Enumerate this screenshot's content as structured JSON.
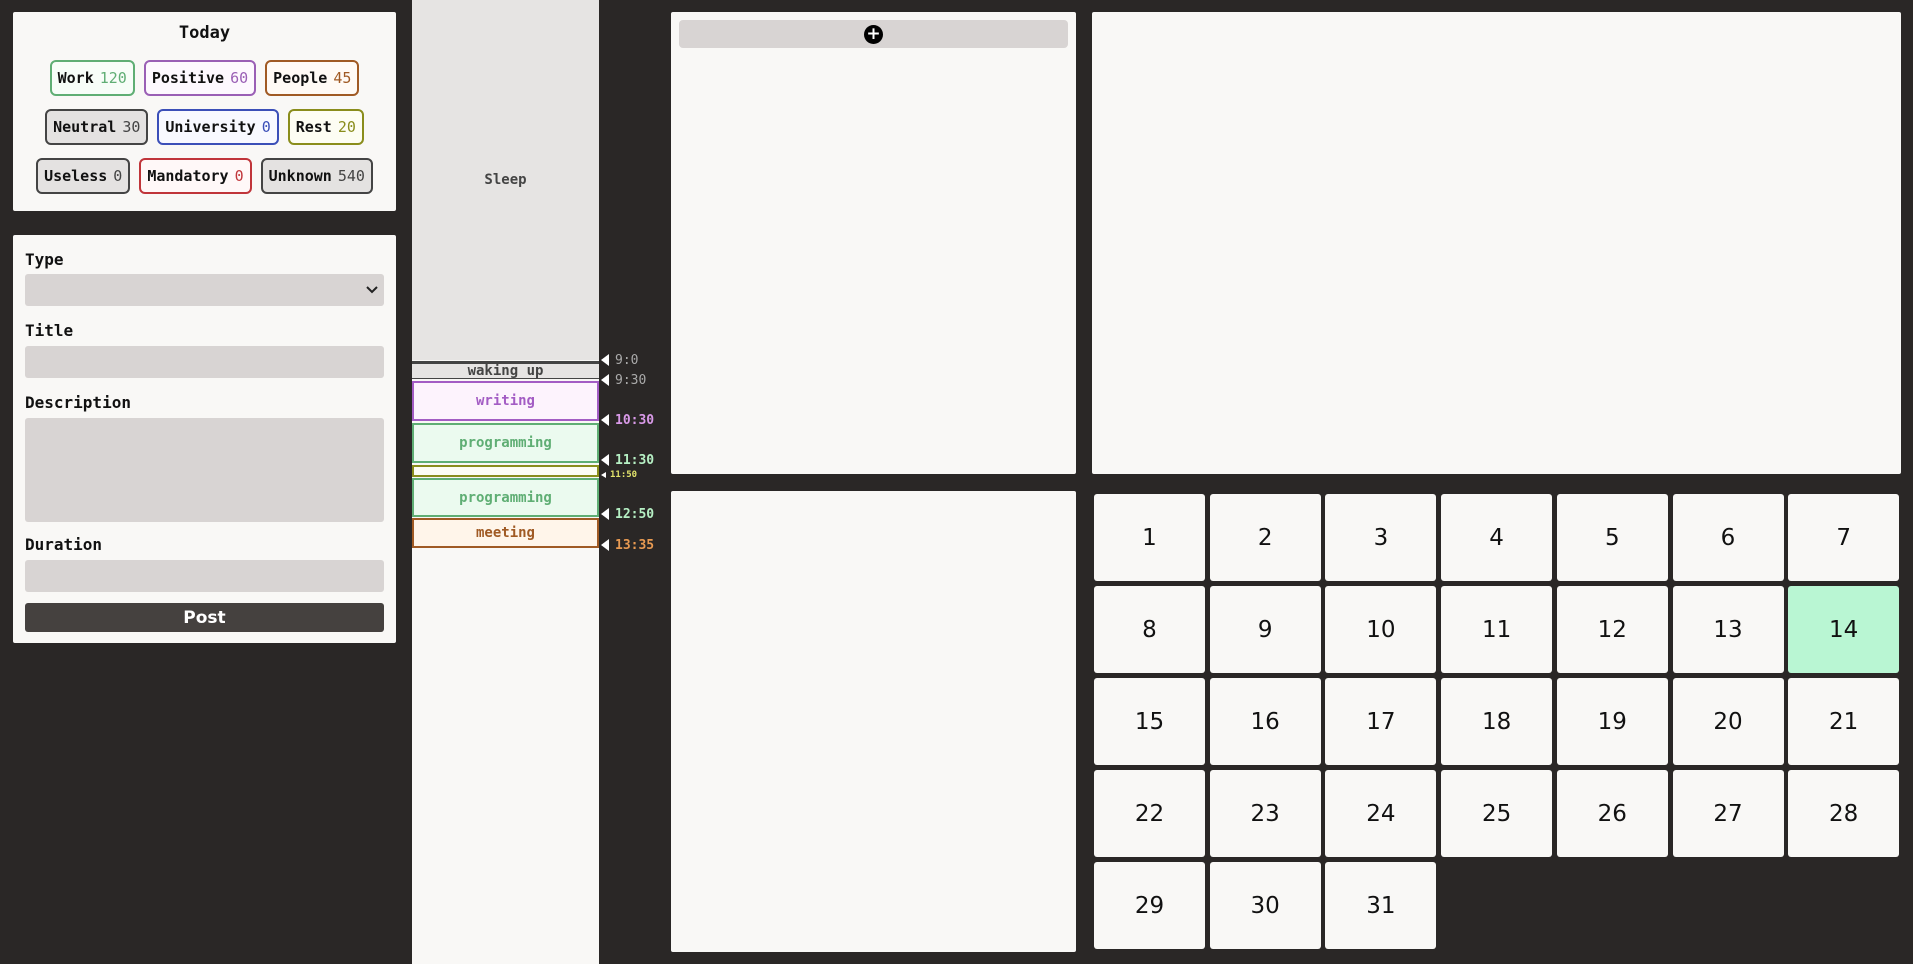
{
  "summary": {
    "title": "Today",
    "tags": [
      {
        "name": "Work",
        "count": "120",
        "border": "#5fae74",
        "color": "#5fae74",
        "bg": "#f7fdf8"
      },
      {
        "name": "Positive",
        "count": "60",
        "border": "#9a5fb5",
        "color": "#9a5fb5",
        "bg": "#fdf8fe"
      },
      {
        "name": "People",
        "count": "45",
        "border": "#a05a24",
        "color": "#a05a24",
        "bg": "#fffaf5"
      },
      {
        "name": "Neutral",
        "count": "30",
        "border": "#444444",
        "color": "#444444",
        "bg": "#e4e2e1"
      },
      {
        "name": "University",
        "count": "0",
        "border": "#3b4fb8",
        "color": "#3b4fb8",
        "bg": "#f8f9ff"
      },
      {
        "name": "Rest",
        "count": "20",
        "border": "#8a8d1c",
        "color": "#8a8d1c",
        "bg": "#fdfdf3"
      },
      {
        "name": "Useless",
        "count": "0",
        "border": "#444444",
        "color": "#444444",
        "bg": "#e4e2e1"
      },
      {
        "name": "Mandatory",
        "count": "0",
        "border": "#c0353a",
        "color": "#c0353a",
        "bg": "#fff8f8"
      },
      {
        "name": "Unknown",
        "count": "540",
        "border": "#444444",
        "color": "#444444",
        "bg": "#e4e2e1"
      }
    ]
  },
  "form": {
    "type_label": "Type",
    "type_value": "",
    "title_label": "Title",
    "title_value": "",
    "description_label": "Description",
    "description_value": "",
    "duration_label": "Duration",
    "duration_value": "",
    "post_label": "Post",
    "chevron_icon": "chevron-down-icon"
  },
  "timeline": {
    "blocks": [
      {
        "label": "Sleep",
        "border": "#e6e4e3",
        "color": "#444444",
        "bg": "#e6e4e3"
      },
      {
        "label": "waking up",
        "border": "#444444",
        "color": "#444444",
        "bg": "#e6e4e3"
      },
      {
        "label": "writing",
        "border": "#a35cc4",
        "color": "#a35cc4",
        "bg": "#fdf3fd"
      },
      {
        "label": "programming",
        "border": "#5fae74",
        "color": "#5fae74",
        "bg": "#ebfaef"
      },
      {
        "label": "",
        "border": "#8a8d1c",
        "color": "#8a8d1c",
        "bg": "#fdfdf3"
      },
      {
        "label": "programming",
        "border": "#5fae74",
        "color": "#5fae74",
        "bg": "#ebfaef"
      },
      {
        "label": "meeting",
        "border": "#a05a24",
        "color": "#a05a24",
        "bg": "#fff5ea"
      }
    ],
    "ticks": [
      {
        "label": "9:0",
        "color": "#aaaaaa"
      },
      {
        "label": "9:30",
        "color": "#aaaaaa"
      },
      {
        "label": "10:30",
        "color": "#d99ae8"
      },
      {
        "label": "11:30",
        "color": "#b6f0c4"
      },
      {
        "label": "11:50",
        "color": "#e2e36c"
      },
      {
        "label": "12:50",
        "color": "#b6f0c4"
      },
      {
        "label": "13:35",
        "color": "#e89a52"
      }
    ]
  },
  "notes": {
    "add_icon": "plus-circle-icon",
    "add_symbol": "+"
  },
  "calendar": {
    "days": [
      "1",
      "2",
      "3",
      "4",
      "5",
      "6",
      "7",
      "8",
      "9",
      "10",
      "11",
      "12",
      "13",
      "14",
      "15",
      "16",
      "17",
      "18",
      "19",
      "20",
      "21",
      "22",
      "23",
      "24",
      "25",
      "26",
      "27",
      "28",
      "29",
      "30",
      "31"
    ],
    "selected": "14",
    "selected_color": "#b9f6d3"
  }
}
